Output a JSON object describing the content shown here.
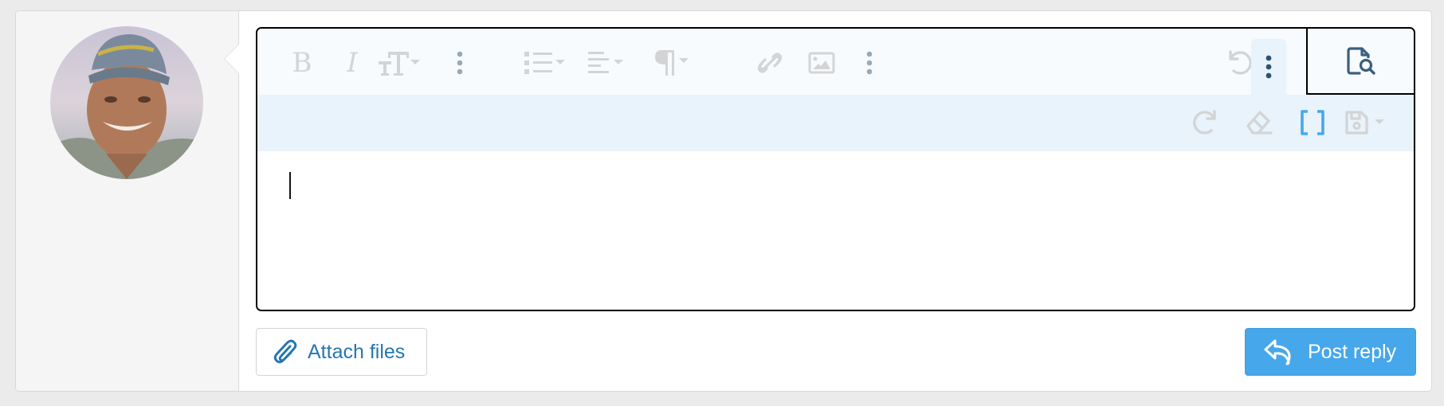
{
  "user": {
    "avatar_alt": "User avatar"
  },
  "toolbar": {
    "row1": [
      {
        "id": "bold",
        "icon": "bold-icon",
        "label": "B"
      },
      {
        "id": "italic",
        "icon": "italic-icon",
        "label": "I"
      },
      {
        "id": "font-size",
        "icon": "text-size-icon",
        "label": "TT",
        "dropdown": true
      },
      {
        "id": "more-text",
        "icon": "more-vertical-icon"
      },
      {
        "id": "list",
        "icon": "list-icon",
        "dropdown": true
      },
      {
        "id": "align",
        "icon": "align-icon",
        "dropdown": true
      },
      {
        "id": "paragraph",
        "icon": "paragraph-icon",
        "label": "¶",
        "dropdown": true
      },
      {
        "id": "link",
        "icon": "link-icon"
      },
      {
        "id": "image",
        "icon": "image-icon"
      },
      {
        "id": "more-insert",
        "icon": "more-vertical-icon"
      },
      {
        "id": "undo",
        "icon": "undo-icon"
      },
      {
        "id": "more-misc",
        "icon": "more-vertical-icon",
        "active": true
      },
      {
        "id": "preview",
        "icon": "preview-icon"
      }
    ],
    "row2": [
      {
        "id": "redo",
        "icon": "redo-icon"
      },
      {
        "id": "remove-format",
        "icon": "eraser-icon"
      },
      {
        "id": "toggle-bbcode",
        "icon": "brackets-icon",
        "active": true
      },
      {
        "id": "drafts",
        "icon": "save-icon",
        "dropdown": true
      }
    ]
  },
  "editor": {
    "content": ""
  },
  "actions": {
    "attach_label": "Attach files",
    "post_label": "Post reply"
  },
  "colors": {
    "accent": "#47a7eb",
    "link": "#2577b1",
    "icon_disabled": "#d4d4d4",
    "icon_dark": "#3b5f7e"
  }
}
